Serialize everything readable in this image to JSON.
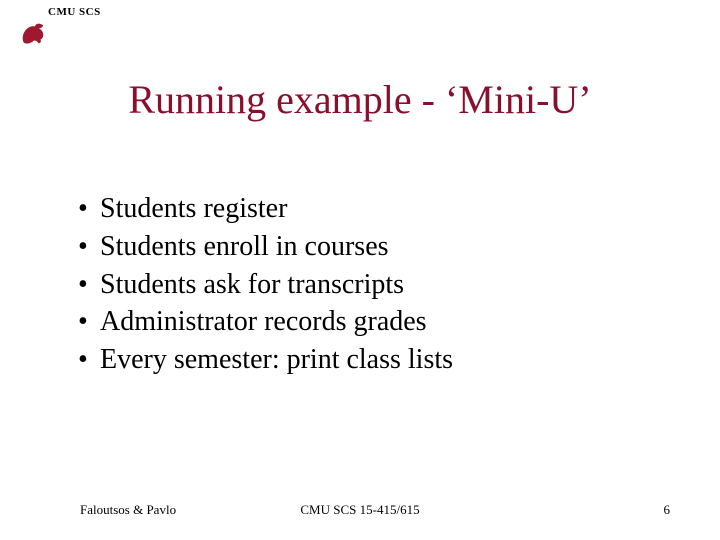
{
  "header": {
    "label": "CMU SCS"
  },
  "title": "Running example - ‘Mini-U’",
  "bullets": [
    "Students register",
    "Students enroll in courses",
    "Students ask for transcripts",
    "Administrator records grades",
    "Every semester: print class lists"
  ],
  "footer": {
    "left": "Faloutsos & Pavlo",
    "center": "CMU SCS 15-415/615",
    "right": "6"
  },
  "colors": {
    "title": "#8a0f2d",
    "logo": "#a01830"
  }
}
